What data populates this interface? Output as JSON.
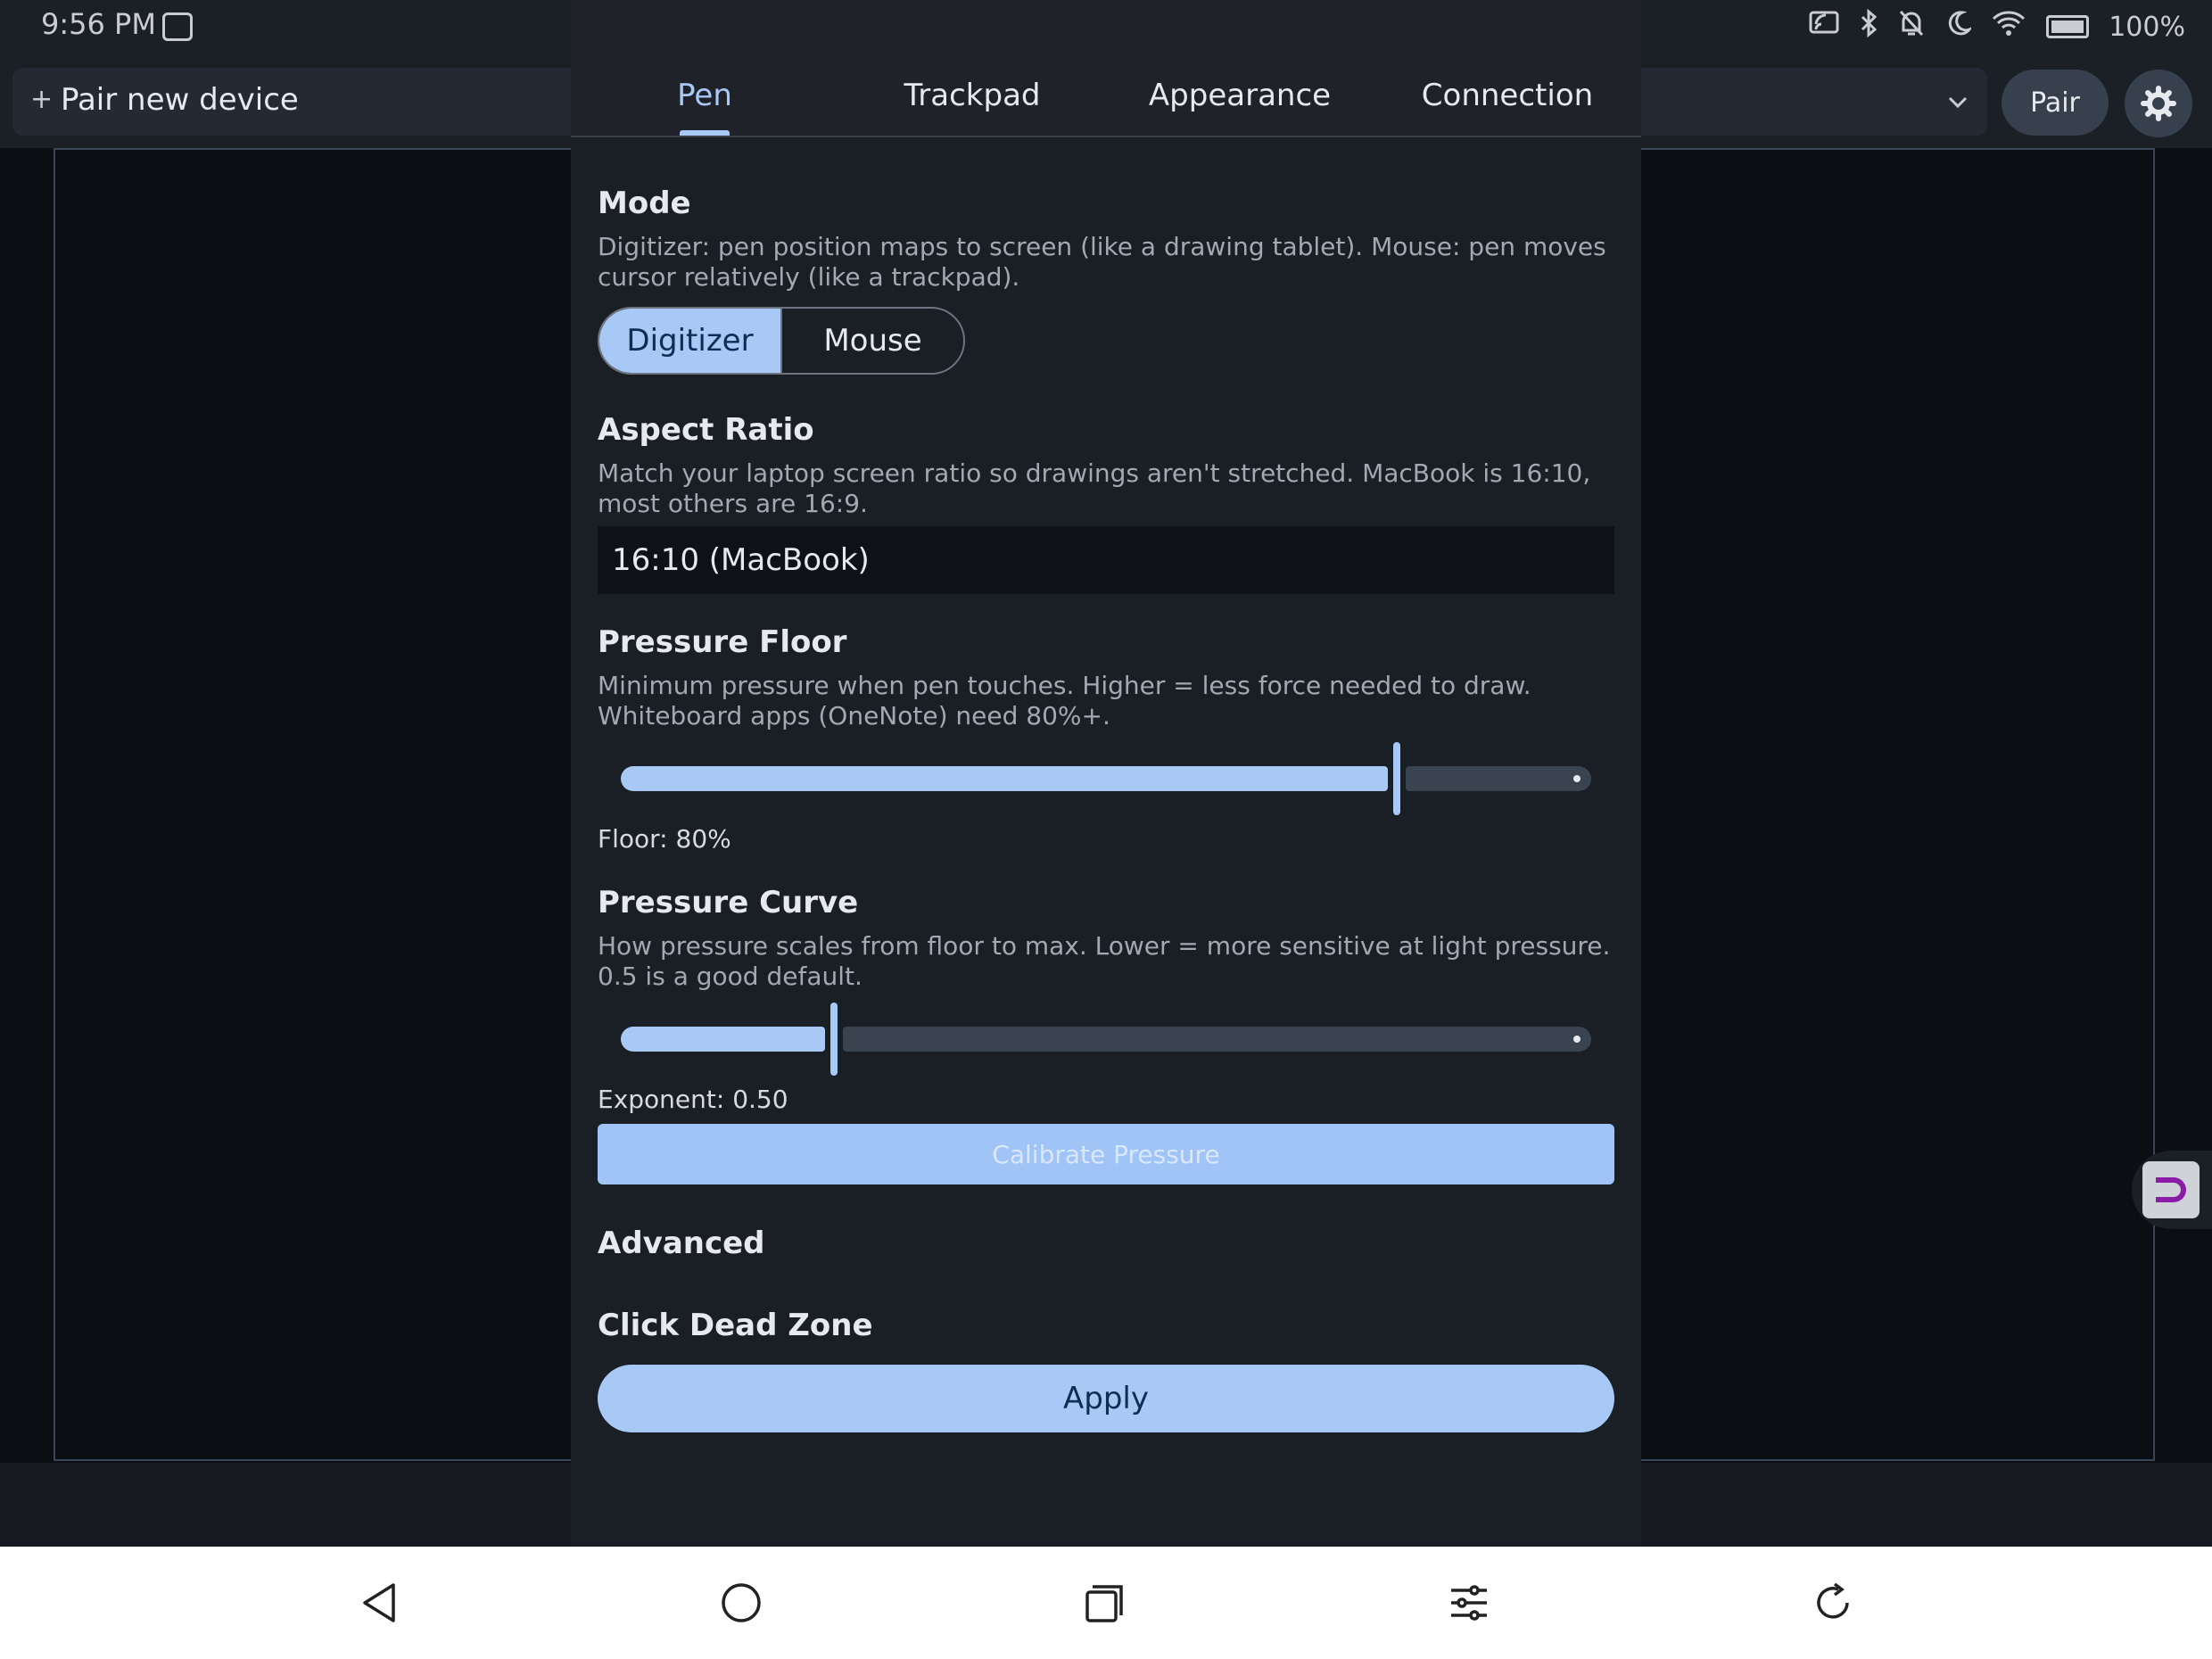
{
  "status": {
    "time": "9:56 PM",
    "battery": "100%"
  },
  "header": {
    "plus": "+",
    "pair_field_label": "Pair new device",
    "pair_button": "Pair"
  },
  "tabs": [
    {
      "label": "Pen"
    },
    {
      "label": "Trackpad"
    },
    {
      "label": "Appearance"
    },
    {
      "label": "Connection"
    }
  ],
  "pen": {
    "mode": {
      "title": "Mode",
      "description": "Digitizer: pen position maps to screen (like a drawing tablet). Mouse: pen moves cursor relatively (like a trackpad).",
      "options": [
        "Digitizer",
        "Mouse"
      ],
      "selected": "Digitizer"
    },
    "aspect_ratio": {
      "title": "Aspect Ratio",
      "description": "Match your laptop screen ratio so drawings aren't stretched. MacBook is 16:10, most others are 16:9.",
      "value": "16:10 (MacBook)"
    },
    "pressure_floor": {
      "title": "Pressure Floor",
      "description": "Minimum pressure when pen touches. Higher = less force needed to draw. Whiteboard apps (OneNote) need 80%+.",
      "value_label": "Floor: 80%",
      "fraction": 0.8
    },
    "pressure_curve": {
      "title": "Pressure Curve",
      "description": "How pressure scales from floor to max. Lower = more sensitive at light pressure. 0.5 is a good default.",
      "value_label": "Exponent: 0.50",
      "fraction": 0.22
    },
    "calibrate_button": "Calibrate Pressure",
    "advanced_title": "Advanced",
    "click_dead_zone_title": "Click Dead Zone",
    "apply_button": "Apply"
  },
  "colors": {
    "accent": "#a8c8f5",
    "panel": "#1a1e25",
    "background": "#0b0f14",
    "floating_logo": "#8a1ca8"
  },
  "icons": {
    "status": [
      "app-icon",
      "cast-icon",
      "bluetooth-icon",
      "bell-off-icon",
      "moon-icon",
      "wifi-icon",
      "battery-icon"
    ],
    "nav": [
      "back-icon",
      "home-icon",
      "recents-icon",
      "sliders-icon",
      "rotate-icon"
    ]
  }
}
